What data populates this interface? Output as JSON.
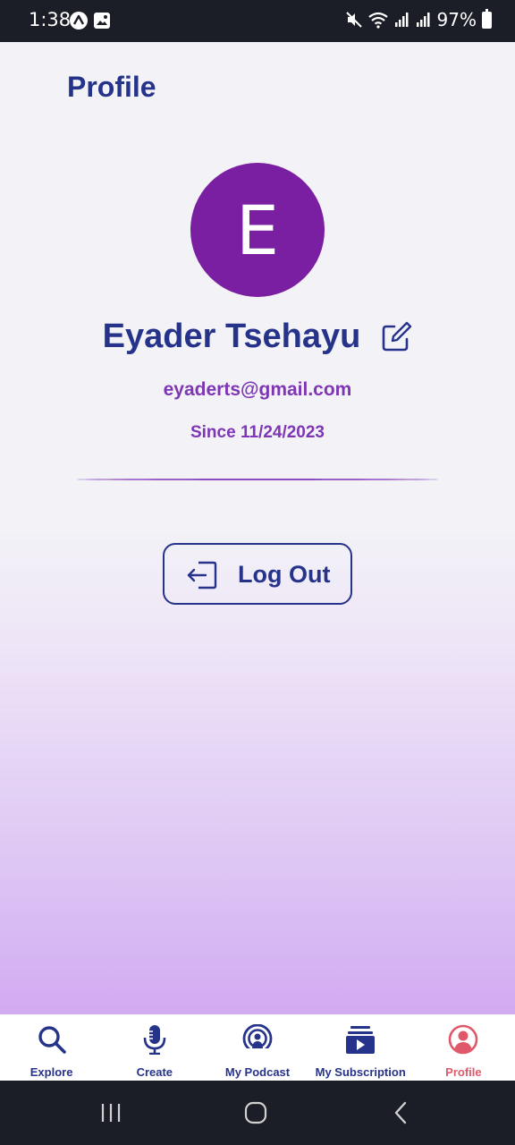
{
  "status_bar": {
    "time": "1:38",
    "battery": "97%",
    "icons": [
      "app-a-icon",
      "image-icon",
      "mute-icon",
      "wifi-icon",
      "signal-icon",
      "signal-icon",
      "battery-icon"
    ]
  },
  "header": {
    "title": "Profile"
  },
  "profile": {
    "avatar_initial": "E",
    "avatar_color": "#7b1fa2",
    "name": "Eyader Tsehayu",
    "email": "eyaderts@gmail.com",
    "since": "Since 11/24/2023"
  },
  "logout": {
    "label": "Log Out",
    "icon": "logout-icon"
  },
  "bottom_nav": {
    "items": [
      {
        "label": "Explore",
        "icon": "search-icon",
        "active": false
      },
      {
        "label": "Create",
        "icon": "microphone-icon",
        "active": false
      },
      {
        "label": "My Podcast",
        "icon": "podcast-icon",
        "active": false
      },
      {
        "label": "My Subscription",
        "icon": "subscription-icon",
        "active": false
      },
      {
        "label": "Profile",
        "icon": "profile-icon",
        "active": true
      }
    ]
  },
  "colors": {
    "primary": "#26338a",
    "accent": "#7e36b4",
    "active_nav": "#e0596a",
    "status_bar": "#1b1e27"
  }
}
